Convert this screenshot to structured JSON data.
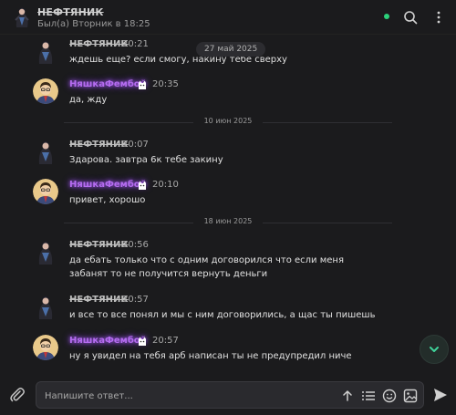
{
  "header": {
    "name": "НЕФТЯНИК",
    "status": "Был(а) Вторник в 18:25",
    "online_color": "#2bd17a",
    "icons": [
      "search-icon",
      "more-vertical-icon"
    ]
  },
  "floating_date": "27 май 2025",
  "dividers": [
    "10 июн 2025",
    "18 июн 2025"
  ],
  "messages": [
    {
      "author": "НЕФТЯНИК",
      "time": "20:21",
      "text": "ждешь еще? если смогу, накину тебе сверху"
    },
    {
      "author": "НяшкаФембой",
      "time": "20:35",
      "text": "да, жду"
    },
    {
      "author": "НЕФТЯНИК",
      "time": "20:07",
      "text": "Здарова. завтра 6к тебе закину"
    },
    {
      "author": "НяшкаФембой",
      "time": "20:10",
      "text": "привет, хорошо"
    },
    {
      "author": "НЕФТЯНИК",
      "time": "20:56",
      "text": "да ебать только что с одним договорился что если меня забанят то не получится вернуть деньги"
    },
    {
      "author": "НЕФТЯНИК",
      "time": "20:57",
      "text": "и все то все понял и мы с ним договорились, а щас ты пишешь"
    },
    {
      "author": "НяшкаФембой",
      "time": "20:57",
      "text": "ну я увидел на тебя арб написан ты не предупредил ниче"
    }
  ],
  "composer": {
    "placeholder": "Напишите ответ...",
    "tools": [
      "format-icon",
      "list-icon",
      "emoji-icon",
      "image-icon"
    ]
  },
  "colors": {
    "background": "#1b1b1d",
    "nickname_glow": "#b56cf0"
  }
}
